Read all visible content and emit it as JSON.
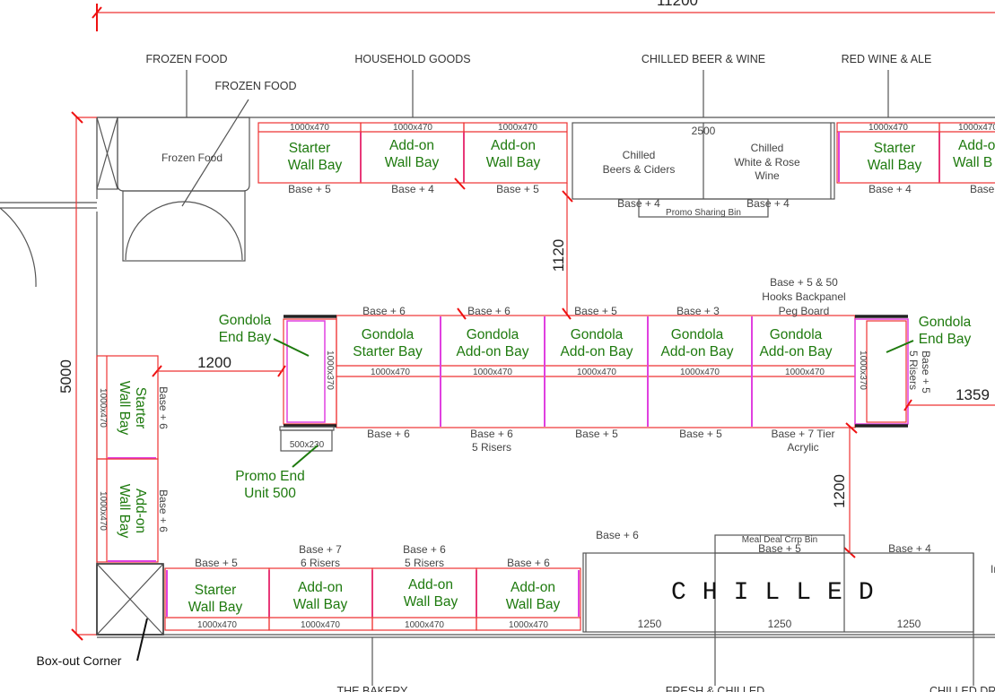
{
  "dimensions": {
    "total_width": "11200",
    "height": "5000",
    "aisle_top": "1120",
    "aisle_left": "1200",
    "aisle_right": "1359",
    "aisle_bottom": "1200",
    "chiller_width": "2500",
    "chilled_bay": "1250"
  },
  "categories": {
    "frozen_food": "FROZEN FOOD",
    "frozen_food_2": "FROZEN FOOD",
    "household": "HOUSEHOLD GOODS",
    "chilled_beer": "CHILLED BEER & WINE",
    "red_wine": "RED WINE & ALE",
    "bakery": "THE BAKERY",
    "fresh_chilled": "FRESH & CHILLED",
    "chilled_drinks": "CHILLED DRI"
  },
  "top_wall": {
    "frozen_unit": "Frozen Food",
    "bays": [
      {
        "name_1": "Starter",
        "name_2": "Wall Bay",
        "size": "1000x470",
        "base": "Base + 5"
      },
      {
        "name_1": "Add-on",
        "name_2": "Wall Bay",
        "size": "1000x470",
        "base": "Base + 4"
      },
      {
        "name_1": "Add-on",
        "name_2": "Wall Bay",
        "size": "1000x470",
        "base": "Base + 5"
      },
      {
        "name_1": "Starter",
        "name_2": "Wall Bay",
        "size": "1000x470",
        "base": "Base + 4"
      },
      {
        "name_1": "Add-on",
        "name_2": "Wall B",
        "size": "1000x470",
        "base": "Base"
      }
    ],
    "chiller_left": {
      "line1": "Chilled",
      "line2": "Beers & Ciders",
      "base": "Base + 4"
    },
    "chiller_right": {
      "line1": "Chilled",
      "line2": "White & Rose",
      "line3": "Wine",
      "base": "Base + 4"
    },
    "promo_bin": "Promo Sharing Bin"
  },
  "gondola": {
    "bays": [
      {
        "name_1": "Gondola",
        "name_2": "Starter Bay",
        "size": "1000x470",
        "top": "Base + 6",
        "bottom": "Base + 6",
        "bottom_2": ""
      },
      {
        "name_1": "Gondola",
        "name_2": "Add-on Bay",
        "size": "1000x470",
        "top": "Base + 6",
        "bottom": "Base + 6",
        "bottom_2": "5 Risers"
      },
      {
        "name_1": "Gondola",
        "name_2": "Add-on Bay",
        "size": "1000x470",
        "top": "Base + 5",
        "bottom": "Base + 5",
        "bottom_2": ""
      },
      {
        "name_1": "Gondola",
        "name_2": "Add-on Bay",
        "size": "1000x470",
        "top": "Base + 3",
        "bottom": "Base + 5",
        "bottom_2": ""
      },
      {
        "name_1": "Gondola",
        "name_2": "Add-on Bay",
        "size": "1000x470",
        "top": "Base + 5 & 50",
        "bottom": "Base + 7 Tier",
        "bottom_2": "Acrylic"
      }
    ],
    "top_note_2": "Hooks Backpanel",
    "top_note_3": "Peg Board",
    "end_size": "1000x370",
    "end_label_1": "Gondola",
    "end_label_2": "End Bay",
    "right_end_base": "Base + 5",
    "right_end_risers": "5 Risers",
    "promo_end_size": "500x230",
    "promo_end_label_1": "Promo End",
    "promo_end_label_2": "Unit 500"
  },
  "left_wall": {
    "bays": [
      {
        "name_1": "Starter",
        "name_2": "Wall Bay",
        "size": "1000x470",
        "base": "Base + 6"
      },
      {
        "name_1": "Add-on",
        "name_2": "Wall Bay",
        "size": "1000x470",
        "base": "Base + 6"
      }
    ],
    "box_out": "Box-out Corner"
  },
  "bottom_wall": {
    "bays": [
      {
        "name_1": "Starter",
        "name_2": "Wall Bay",
        "size": "1000x470",
        "base_1": "",
        "base_2": "Base + 5"
      },
      {
        "name_1": "Add-on",
        "name_2": "Wall Bay",
        "size": "1000x470",
        "base_1": "Base + 7",
        "base_2": "6 Risers"
      },
      {
        "name_1": "Add-on",
        "name_2": "Wall Bay",
        "size": "1000x470",
        "base_1": "Base + 6",
        "base_2": "5 Risers"
      },
      {
        "name_1": "Add-on",
        "name_2": "Wall Bay",
        "size": "1000x470",
        "base_1": "",
        "base_2": "Base + 6"
      }
    ],
    "chilled_title": "CHILLED",
    "chilled_bases": [
      "Base + 6",
      "Base + 5",
      "Base + 4"
    ],
    "meal_deal": "Meal Deal Crrp Bin",
    "partial": "In"
  },
  "colors": {
    "bay_outline": "#ee3333",
    "bay_divider": "#e040e0",
    "label_green": "#1e7a0e",
    "wall": "#555555"
  }
}
